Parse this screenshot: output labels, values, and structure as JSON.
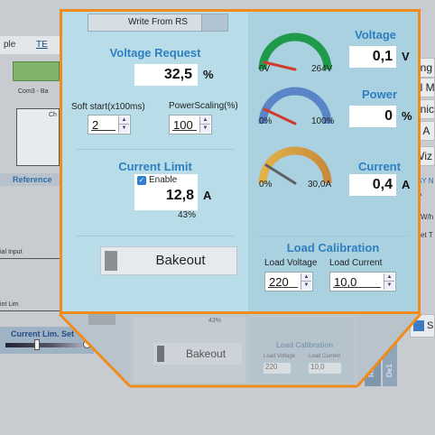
{
  "background": {
    "tab_partial_1": "ple",
    "tab_partial_2": "TE",
    "com_label": "Com3 - Ba",
    "ch_label": "Ch",
    "reference_label": "Reference",
    "ial_input": "ial Input",
    "int_lim": "int Lim",
    "current_lim_set": "Current Lim. Set",
    "right_items": [
      "ring",
      "ol M",
      "unic",
      "d A",
      "Wiz"
    ],
    "right_small": [
      "SY N",
      "A",
      "kW/h",
      "set T"
    ],
    "bottom_percent": "43%",
    "bottom_bakeout": "Bakeout",
    "bottom_load_calibration": "Load Calibration",
    "bottom_load_voltage": "Load Voltage",
    "bottom_load_current": "Load Current",
    "bottom_lv_value": "220",
    "bottom_lc_value": "10,0",
    "vertical_tab_1": "Refraktor",
    "vertical_tab_2": "De1",
    "s_button": "S"
  },
  "panel": {
    "write_from_rs": "Write From RS",
    "voltage_request": {
      "title": "Voltage Request",
      "value": "32,5",
      "unit": "%"
    },
    "soft_start": {
      "label": "Soft start(x100ms)",
      "value": "2"
    },
    "power_scaling": {
      "label": "PowerScaling(%)",
      "value": "100"
    },
    "current_limit": {
      "title": "Current Limit",
      "enable_label": "Enable",
      "enabled": true,
      "value": "12,8",
      "unit": "A",
      "percent": "43%"
    },
    "bakeout_label": "Bakeout",
    "gauges": {
      "voltage": {
        "title": "Voltage",
        "min": "0V",
        "max": "264V",
        "value": "0,1",
        "unit": "V",
        "color": "#1f9a4a",
        "fraction": 0.0
      },
      "power": {
        "title": "Power",
        "min": "0%",
        "max": "100%",
        "value": "0",
        "unit": "%",
        "color": "#5a86c8",
        "fraction": 0.0
      },
      "current": {
        "title": "Current",
        "min": "0%",
        "max": "30,0A",
        "value": "0,4",
        "unit": "A",
        "color": "#d6a040",
        "fraction": 0.013
      }
    },
    "load_calibration": {
      "title": "Load Calibration",
      "load_voltage_label": "Load Voltage",
      "load_current_label": "Load Current",
      "load_voltage_value": "220",
      "load_current_value": "10,0"
    }
  },
  "colors": {
    "accent_orange": "#ef8c1c",
    "title_blue": "#2e7fc0",
    "panel_bg": "#b8dde9"
  }
}
